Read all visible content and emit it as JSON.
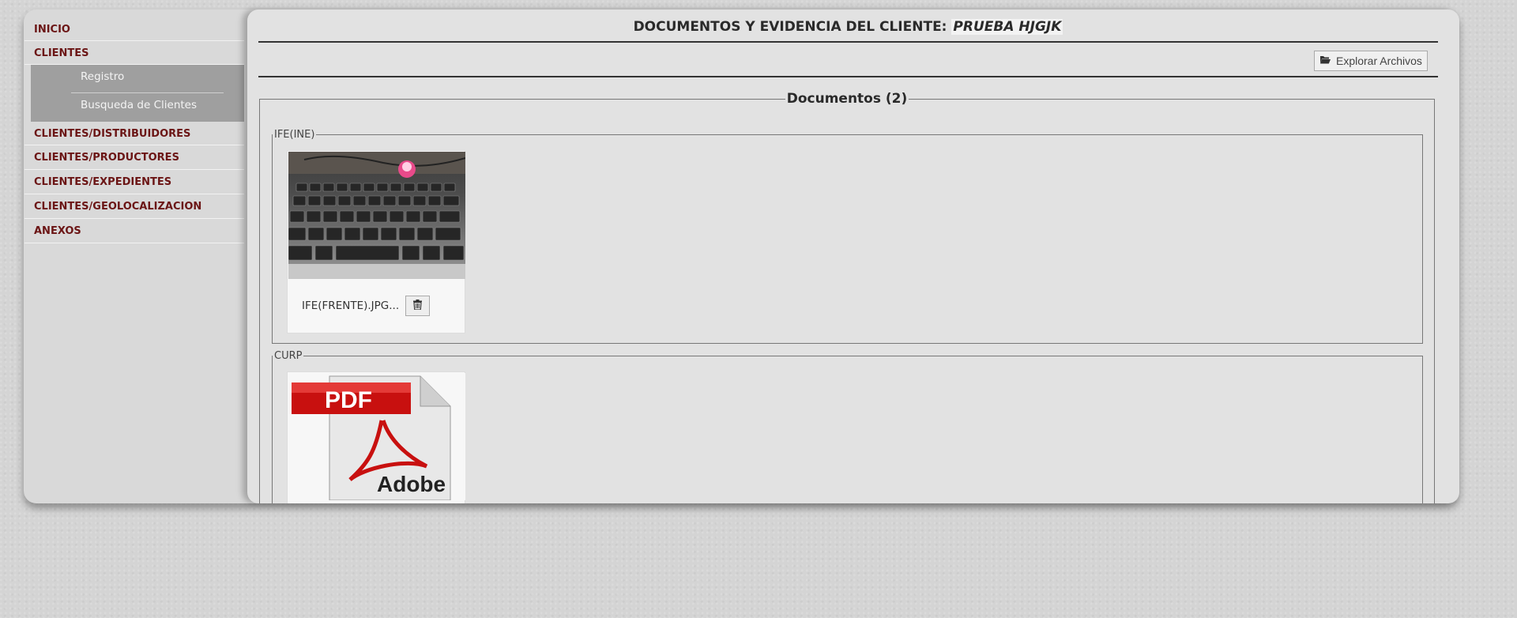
{
  "sidebar": {
    "items": [
      {
        "label": "INICIO"
      },
      {
        "label": "CLIENTES"
      },
      {
        "label": "CLIENTES/DISTRIBUIDORES"
      },
      {
        "label": "CLIENTES/PRODUCTORES"
      },
      {
        "label": "CLIENTES/EXPEDIENTES"
      },
      {
        "label": "CLIENTES/GEOLOCALIZACION"
      },
      {
        "label": "ANEXOS"
      }
    ],
    "submenu": [
      {
        "label": "Registro"
      },
      {
        "label": "Busqueda de Clientes"
      }
    ]
  },
  "header": {
    "title_prefix": "DOCUMENTOS Y EVIDENCIA DEL CLIENTE:",
    "client_name": "PRUEBA HJGJK"
  },
  "toolbar": {
    "explore_label": "Explorar Archivos",
    "explore_icon": "folder-open-icon"
  },
  "documents": {
    "legend": "Documentos (2)",
    "groups": [
      {
        "legend": "IFE(INE)",
        "files": [
          {
            "name": "IFE(FRENTE).JPG...",
            "thumbnail": "keyboard-photo",
            "delete_icon": "trash-icon"
          }
        ]
      },
      {
        "legend": "CURP",
        "files": [
          {
            "thumbnail": "pdf-adobe-icon",
            "pdf_text": "PDF",
            "brand_text": "Adobe"
          }
        ]
      }
    ]
  },
  "colors": {
    "menu_text": "#6b1515",
    "submenu_bg": "#9f9f9f",
    "pdf_red": "#cc0000"
  }
}
